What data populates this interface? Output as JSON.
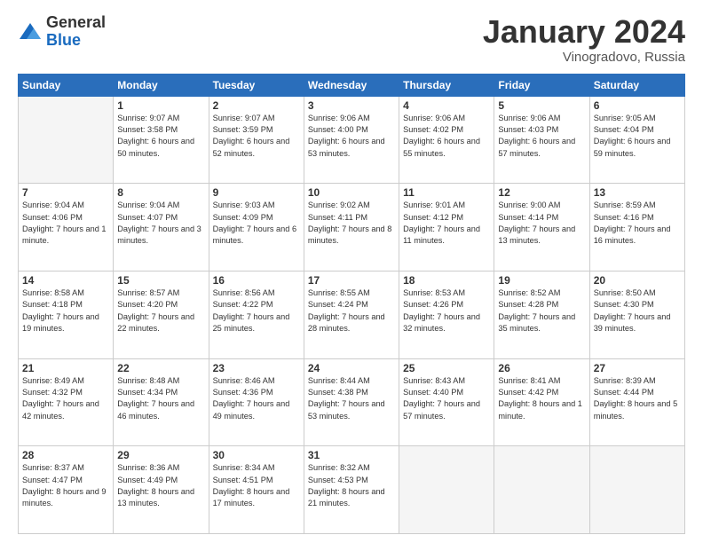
{
  "header": {
    "logo_general": "General",
    "logo_blue": "Blue",
    "month_title": "January 2024",
    "location": "Vinogradovo, Russia"
  },
  "weekdays": [
    "Sunday",
    "Monday",
    "Tuesday",
    "Wednesday",
    "Thursday",
    "Friday",
    "Saturday"
  ],
  "weeks": [
    [
      {
        "day": "",
        "sunrise": "",
        "sunset": "",
        "daylight": ""
      },
      {
        "day": "1",
        "sunrise": "9:07 AM",
        "sunset": "3:58 PM",
        "daylight": "6 hours and 50 minutes."
      },
      {
        "day": "2",
        "sunrise": "9:07 AM",
        "sunset": "3:59 PM",
        "daylight": "6 hours and 52 minutes."
      },
      {
        "day": "3",
        "sunrise": "9:06 AM",
        "sunset": "4:00 PM",
        "daylight": "6 hours and 53 minutes."
      },
      {
        "day": "4",
        "sunrise": "9:06 AM",
        "sunset": "4:02 PM",
        "daylight": "6 hours and 55 minutes."
      },
      {
        "day": "5",
        "sunrise": "9:06 AM",
        "sunset": "4:03 PM",
        "daylight": "6 hours and 57 minutes."
      },
      {
        "day": "6",
        "sunrise": "9:05 AM",
        "sunset": "4:04 PM",
        "daylight": "6 hours and 59 minutes."
      }
    ],
    [
      {
        "day": "7",
        "sunrise": "9:04 AM",
        "sunset": "4:06 PM",
        "daylight": "7 hours and 1 minute."
      },
      {
        "day": "8",
        "sunrise": "9:04 AM",
        "sunset": "4:07 PM",
        "daylight": "7 hours and 3 minutes."
      },
      {
        "day": "9",
        "sunrise": "9:03 AM",
        "sunset": "4:09 PM",
        "daylight": "7 hours and 6 minutes."
      },
      {
        "day": "10",
        "sunrise": "9:02 AM",
        "sunset": "4:11 PM",
        "daylight": "7 hours and 8 minutes."
      },
      {
        "day": "11",
        "sunrise": "9:01 AM",
        "sunset": "4:12 PM",
        "daylight": "7 hours and 11 minutes."
      },
      {
        "day": "12",
        "sunrise": "9:00 AM",
        "sunset": "4:14 PM",
        "daylight": "7 hours and 13 minutes."
      },
      {
        "day": "13",
        "sunrise": "8:59 AM",
        "sunset": "4:16 PM",
        "daylight": "7 hours and 16 minutes."
      }
    ],
    [
      {
        "day": "14",
        "sunrise": "8:58 AM",
        "sunset": "4:18 PM",
        "daylight": "7 hours and 19 minutes."
      },
      {
        "day": "15",
        "sunrise": "8:57 AM",
        "sunset": "4:20 PM",
        "daylight": "7 hours and 22 minutes."
      },
      {
        "day": "16",
        "sunrise": "8:56 AM",
        "sunset": "4:22 PM",
        "daylight": "7 hours and 25 minutes."
      },
      {
        "day": "17",
        "sunrise": "8:55 AM",
        "sunset": "4:24 PM",
        "daylight": "7 hours and 28 minutes."
      },
      {
        "day": "18",
        "sunrise": "8:53 AM",
        "sunset": "4:26 PM",
        "daylight": "7 hours and 32 minutes."
      },
      {
        "day": "19",
        "sunrise": "8:52 AM",
        "sunset": "4:28 PM",
        "daylight": "7 hours and 35 minutes."
      },
      {
        "day": "20",
        "sunrise": "8:50 AM",
        "sunset": "4:30 PM",
        "daylight": "7 hours and 39 minutes."
      }
    ],
    [
      {
        "day": "21",
        "sunrise": "8:49 AM",
        "sunset": "4:32 PM",
        "daylight": "7 hours and 42 minutes."
      },
      {
        "day": "22",
        "sunrise": "8:48 AM",
        "sunset": "4:34 PM",
        "daylight": "7 hours and 46 minutes."
      },
      {
        "day": "23",
        "sunrise": "8:46 AM",
        "sunset": "4:36 PM",
        "daylight": "7 hours and 49 minutes."
      },
      {
        "day": "24",
        "sunrise": "8:44 AM",
        "sunset": "4:38 PM",
        "daylight": "7 hours and 53 minutes."
      },
      {
        "day": "25",
        "sunrise": "8:43 AM",
        "sunset": "4:40 PM",
        "daylight": "7 hours and 57 minutes."
      },
      {
        "day": "26",
        "sunrise": "8:41 AM",
        "sunset": "4:42 PM",
        "daylight": "8 hours and 1 minute."
      },
      {
        "day": "27",
        "sunrise": "8:39 AM",
        "sunset": "4:44 PM",
        "daylight": "8 hours and 5 minutes."
      }
    ],
    [
      {
        "day": "28",
        "sunrise": "8:37 AM",
        "sunset": "4:47 PM",
        "daylight": "8 hours and 9 minutes."
      },
      {
        "day": "29",
        "sunrise": "8:36 AM",
        "sunset": "4:49 PM",
        "daylight": "8 hours and 13 minutes."
      },
      {
        "day": "30",
        "sunrise": "8:34 AM",
        "sunset": "4:51 PM",
        "daylight": "8 hours and 17 minutes."
      },
      {
        "day": "31",
        "sunrise": "8:32 AM",
        "sunset": "4:53 PM",
        "daylight": "8 hours and 21 minutes."
      },
      {
        "day": "",
        "sunrise": "",
        "sunset": "",
        "daylight": ""
      },
      {
        "day": "",
        "sunrise": "",
        "sunset": "",
        "daylight": ""
      },
      {
        "day": "",
        "sunrise": "",
        "sunset": "",
        "daylight": ""
      }
    ]
  ]
}
